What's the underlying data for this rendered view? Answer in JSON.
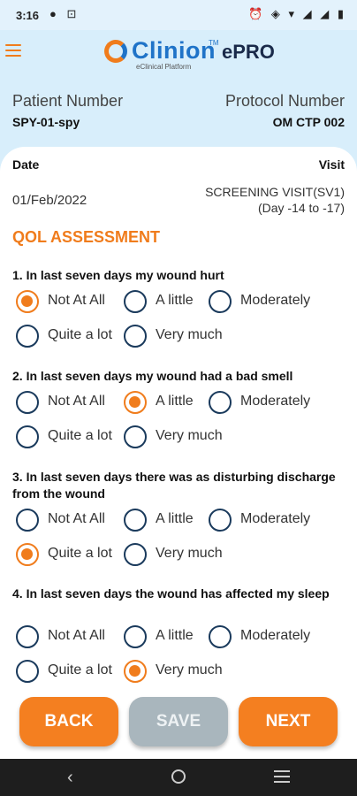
{
  "status": {
    "time": "3:16",
    "left_icons": "● ⊡",
    "right_icons": "⏰ ◈ ▾ ◢ ◢ ▮"
  },
  "header": {
    "logo_text": "Clinion",
    "logo_tm": "TM",
    "logo_sub": "eClinical Platform",
    "product": "ePRO"
  },
  "patient": {
    "label": "Patient Number",
    "value": "SPY-01-spy"
  },
  "protocol": {
    "label": "Protocol Number",
    "value": "OM CTP 002"
  },
  "date": {
    "label": "Date",
    "value": "01/Feb/2022"
  },
  "visit": {
    "label": "Visit",
    "line1": "SCREENING VISIT(SV1)",
    "line2": "(Day -14 to -17)"
  },
  "section_title": "QOL ASSESSMENT",
  "option_labels": [
    "Not At All",
    "A little",
    "Moderately",
    "Quite a lot",
    "Very much"
  ],
  "questions": [
    {
      "text": "1. In last seven days my wound hurt",
      "selected": "Not At All"
    },
    {
      "text": "2. In last seven days my wound had a bad smell",
      "selected": "A little"
    },
    {
      "text": "3. In last seven days there was as disturbing discharge from the wound",
      "selected": "Quite a lot"
    },
    {
      "text": "4. In last seven days the wound has affected my sleep",
      "selected": "Very much"
    }
  ],
  "buttons": {
    "back": "BACK",
    "save": "SAVE",
    "next": "NEXT"
  },
  "colors": {
    "accent": "#f07c1c",
    "brand_blue": "#1f73c8",
    "disabled": "#a9b6bd"
  }
}
